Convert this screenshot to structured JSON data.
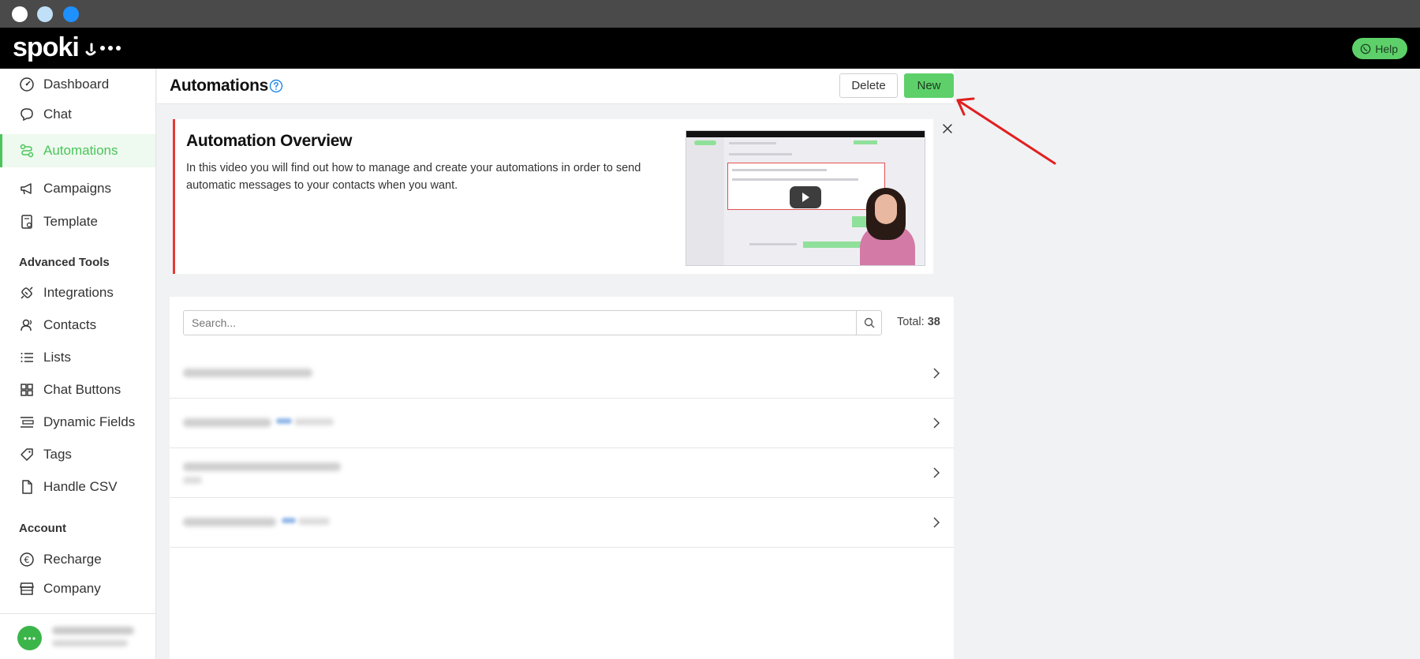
{
  "app": {
    "brand": "spoki",
    "help_label": "Help"
  },
  "sidebar": {
    "items": [
      {
        "label": "Dashboard",
        "icon": "gauge-icon"
      },
      {
        "label": "Chat",
        "icon": "chat-bubble-icon"
      },
      {
        "label": "Automations",
        "icon": "automation-icon",
        "active": true
      },
      {
        "label": "Campaigns",
        "icon": "megaphone-icon"
      },
      {
        "label": "Template",
        "icon": "template-icon"
      }
    ],
    "advanced_title": "Advanced Tools",
    "advanced_items": [
      {
        "label": "Integrations",
        "icon": "plug-icon"
      },
      {
        "label": "Contacts",
        "icon": "contacts-icon"
      },
      {
        "label": "Lists",
        "icon": "list-icon"
      },
      {
        "label": "Chat Buttons",
        "icon": "grid-icon"
      },
      {
        "label": "Dynamic Fields",
        "icon": "fields-icon"
      },
      {
        "label": "Tags",
        "icon": "tag-icon"
      },
      {
        "label": "Handle CSV",
        "icon": "csv-file-icon"
      }
    ],
    "account_title": "Account",
    "account_items": [
      {
        "label": "Recharge",
        "icon": "euro-icon"
      },
      {
        "label": "Company",
        "icon": "store-icon"
      }
    ]
  },
  "header": {
    "title": "Automations",
    "delete_label": "Delete",
    "new_label": "New"
  },
  "overview": {
    "title": "Automation Overview",
    "description": "In this video you will find out how to manage and create your automations in order to send automatic messages to your contacts when you want."
  },
  "list": {
    "search_placeholder": "Search...",
    "total_label": "Total:",
    "total_value": "38"
  },
  "colors": {
    "accent": "#4bc55b",
    "button_green": "#5dd06a",
    "alert_red": "#e53935",
    "link_blue": "#1e88e5"
  }
}
